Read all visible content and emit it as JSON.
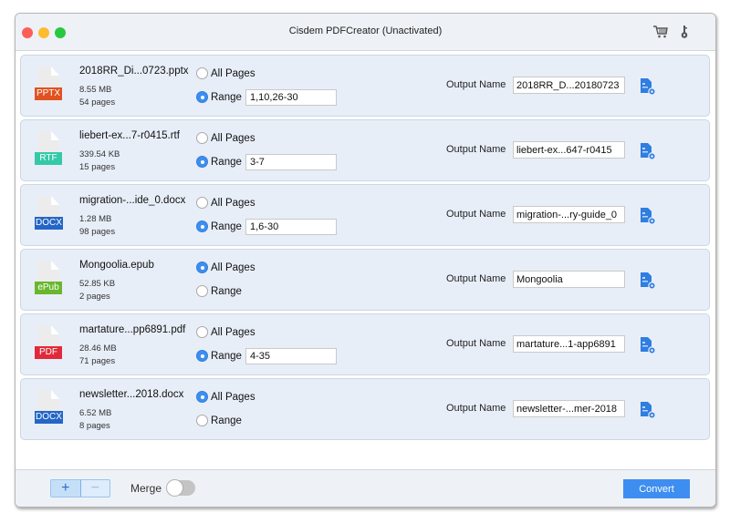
{
  "window": {
    "title": "Cisdem PDFCreator (Unactivated)",
    "toolbar_icons": [
      "cart-icon",
      "key-icon"
    ]
  },
  "files": [
    {
      "name": "2018RR_Di...0723.pptx",
      "size": "8.55 MB",
      "pages": "54 pages",
      "type": "PPTX",
      "type_color": "#e0521f",
      "all_pages_label": "All Pages",
      "range_label": "Range",
      "mode": "range",
      "range_value": "1,10,26-30",
      "output_label": "Output Name",
      "output_name": "2018RR_D...20180723"
    },
    {
      "name": "liebert-ex...7-r0415.rtf",
      "size": "339.54 KB",
      "pages": "15 pages",
      "type": "RTF",
      "type_color": "#34c9a8",
      "all_pages_label": "All Pages",
      "range_label": "Range",
      "mode": "range",
      "range_value": "3-7",
      "output_label": "Output Name",
      "output_name": "liebert-ex...647-r0415"
    },
    {
      "name": "migration-...ide_0.docx",
      "size": "1.28 MB",
      "pages": "98 pages",
      "type": "DOCX",
      "type_color": "#2466c7",
      "all_pages_label": "All Pages",
      "range_label": "Range",
      "mode": "range",
      "range_value": "1,6-30",
      "output_label": "Output Name",
      "output_name": "migration-...ry-guide_0"
    },
    {
      "name": "Mongoolia.epub",
      "size": "52.85 KB",
      "pages": "2 pages",
      "type": "ePub",
      "type_color": "#6ab72e",
      "all_pages_label": "All Pages",
      "range_label": "Range",
      "mode": "all",
      "range_value": "",
      "output_label": "Output Name",
      "output_name": "Mongoolia"
    },
    {
      "name": "martature...pp6891.pdf",
      "size": "28.46 MB",
      "pages": "71 pages",
      "type": "PDF",
      "type_color": "#e02a3a",
      "all_pages_label": "All Pages",
      "range_label": "Range",
      "mode": "range",
      "range_value": "4-35",
      "output_label": "Output Name",
      "output_name": "martature...1-app6891"
    },
    {
      "name": "newsletter...2018.docx",
      "size": "6.52 MB",
      "pages": "8 pages",
      "type": "DOCX",
      "type_color": "#2466c7",
      "all_pages_label": "All Pages",
      "range_label": "Range",
      "mode": "all",
      "range_value": "",
      "output_label": "Output Name",
      "output_name": "newsletter-...mer-2018"
    }
  ],
  "footer": {
    "add_label": "+",
    "remove_label": "−",
    "merge_label": "Merge",
    "merge_on": false,
    "convert_label": "Convert"
  },
  "colors": {
    "accent": "#3d8ef0",
    "row_bg": "#e8eef8"
  }
}
